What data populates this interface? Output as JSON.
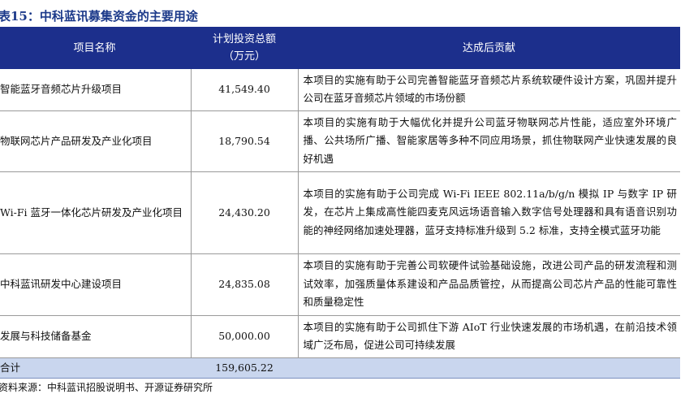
{
  "title": "表15：中科蓝讯募集资金的主要用途",
  "table": {
    "headers": {
      "project": "项目名称",
      "amount_line1": "计划投资总额",
      "amount_line2": "（万元）",
      "outcome": "达成后贡献"
    },
    "rows": [
      {
        "project": "智能蓝牙音频芯片升级项目",
        "amount": "41,549.40",
        "outcome": "本项目的实施有助于公司完善智能蓝牙音频芯片系统软硬件设计方案，巩固并提升公司在蓝牙音频芯片领域的市场份额"
      },
      {
        "project": "物联网芯片产品研发及产业化项目",
        "amount": "18,790.54",
        "outcome": "本项目的实施有助于大幅优化并提升公司蓝牙物联网芯片性能，适应室外环境广播、公共场所广播、智能家居等多种不同应用场景，抓住物联网产业快速发展的良好机遇"
      },
      {
        "project": "Wi-Fi 蓝牙一体化芯片研发及产业化项目",
        "amount": "24,430.20",
        "outcome": "本项目的实施有助于公司完成 Wi-Fi IEEE 802.11a/b/g/n 模拟 IP 与数字 IP 研发，在芯片上集成高性能四麦克风远场语音输入数字信号处理器和具有语音识别功能的神经网络加速处理器，蓝牙支持标准升级到 5.2 标准，支持全模式蓝牙功能"
      },
      {
        "project": "中科蓝讯研发中心建设项目",
        "amount": "24,835.08",
        "outcome": "本项目的实施有助于完善公司软硬件试验基础设施，改进公司产品的研发流程和测试效率，加强质量体系建设和产品品质管控，从而提高公司芯片产品的性能可靠性和质量稳定性"
      },
      {
        "project": "发展与科技储备基金",
        "amount": "50,000.00",
        "outcome": "本项目的实施有助于公司抓住下游 AIoT 行业快速发展的市场机遇，在前沿技术领域广泛布局，促进公司可持续发展"
      }
    ],
    "total": {
      "label": "合计",
      "amount": "159,605.22"
    }
  },
  "source": "资料来源：中科蓝讯招股说明书、开源证券研究所"
}
